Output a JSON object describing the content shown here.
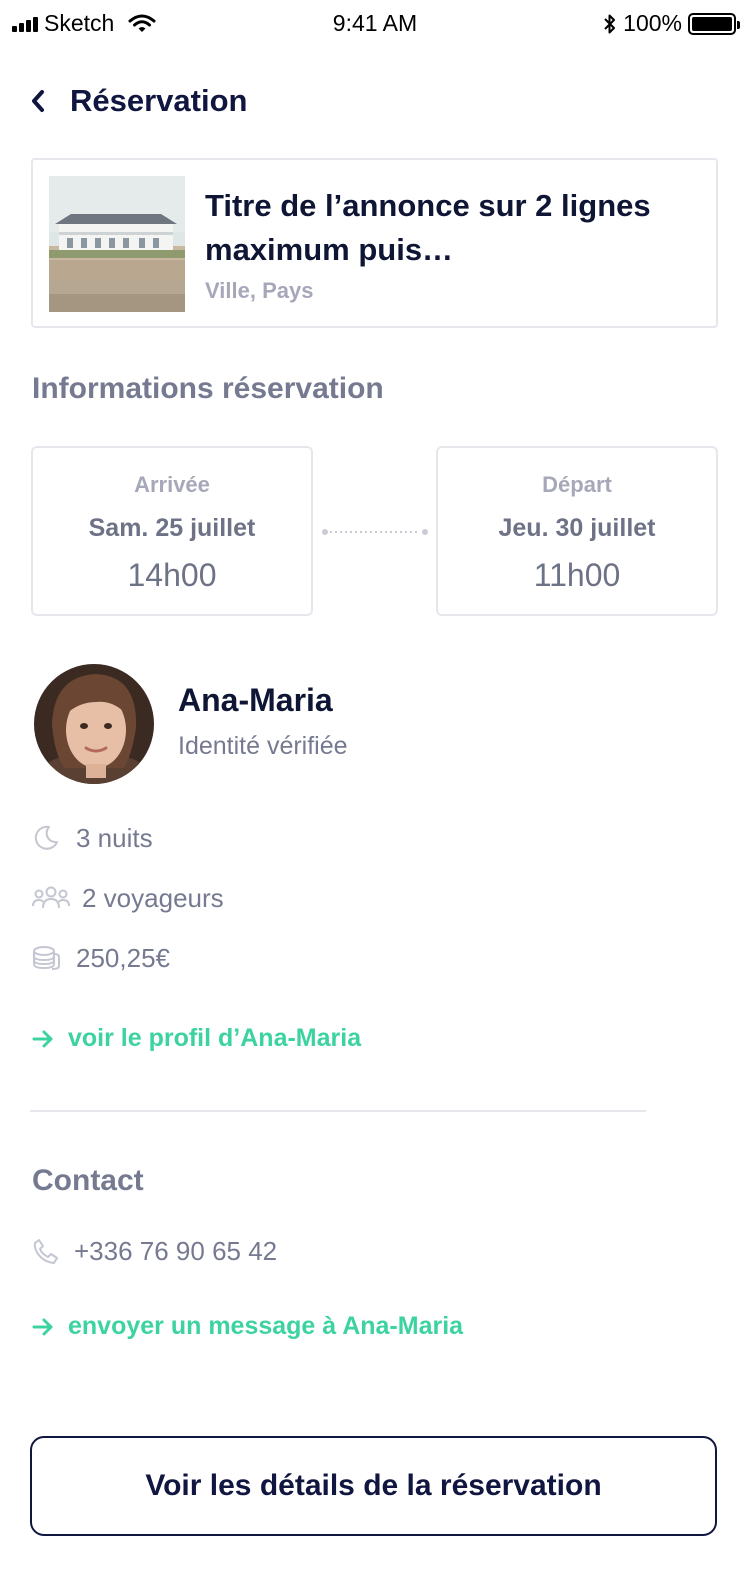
{
  "status_bar": {
    "carrier": "Sketch",
    "time": "9:41 AM",
    "battery": "100%",
    "battery_level": 1.0
  },
  "nav": {
    "title": "Réservation",
    "back_icon": "chevron-left-icon"
  },
  "listing": {
    "title": "Titre de l’annonce sur 2 lignes maximum puis…",
    "location": "Ville, Pays"
  },
  "booking_info": {
    "section_title": "Informations réservation",
    "arrival": {
      "label": "Arrivée",
      "day": "Sam. 25 juillet",
      "time": "14h00"
    },
    "departure": {
      "label": "Départ",
      "day": "Jeu. 30 juillet",
      "time": "11h00"
    }
  },
  "guest": {
    "name": "Ana-Maria",
    "status": "Identité vérifiée",
    "nights": "3 nuits",
    "travelers": "2 voyageurs",
    "price": "250,25€",
    "profile_link": "voir le profil d’Ana-Maria"
  },
  "contact": {
    "section_title": "Contact",
    "phone": "+336 76 90 65 42",
    "message_link": "envoyer un message à Ana-Maria"
  },
  "cta": {
    "label": "Voir les détails de la réservation"
  },
  "colors": {
    "navy": "#101640",
    "gray": "#767a91",
    "light_gray": "#a6a8b9",
    "border": "#e6e7ec",
    "accent_green": "#3dd3a0"
  }
}
